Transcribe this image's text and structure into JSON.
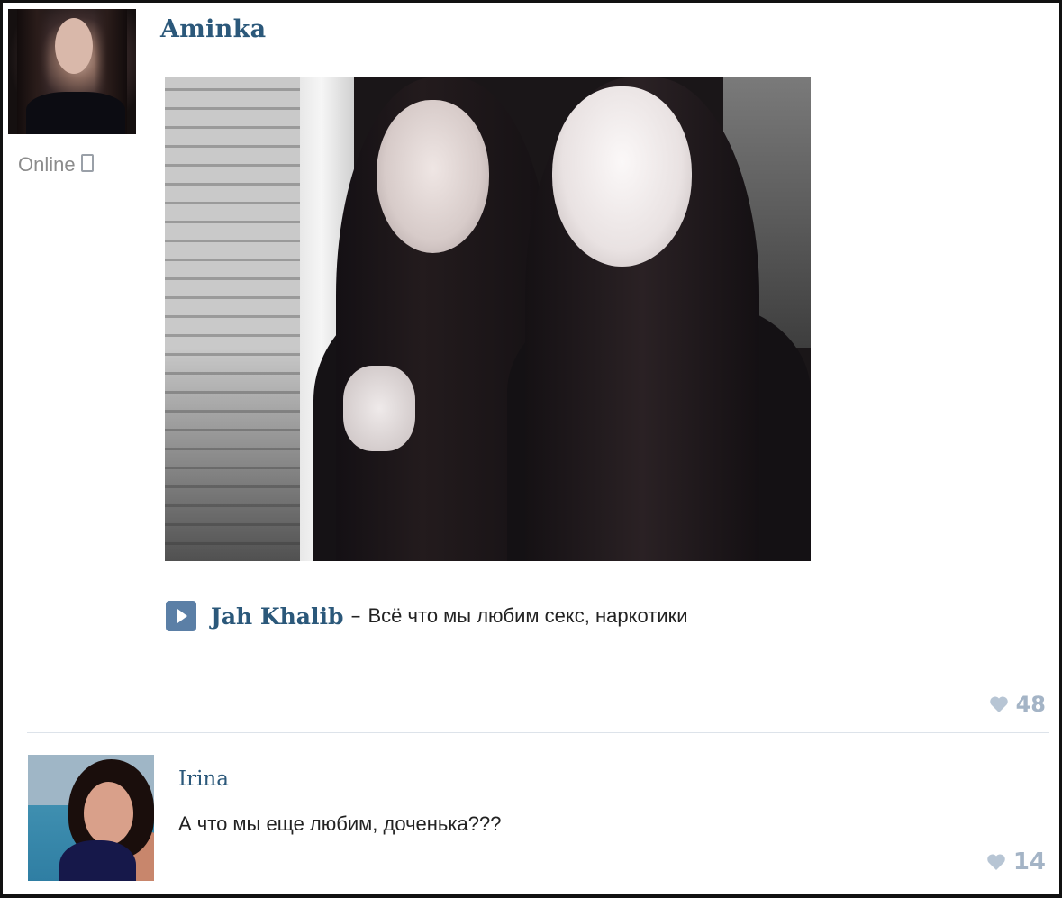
{
  "post": {
    "author": "Aminka",
    "status": "Online",
    "status_icon": "mobile-phone-icon",
    "audio": {
      "artist": "Jah Khalib",
      "separator": "–",
      "title": "Всё что мы любим секс, наркотики"
    },
    "likes": "48"
  },
  "comment": {
    "author": "Irina",
    "text": "А что мы еще любим, доченька???",
    "likes": "14"
  },
  "colors": {
    "link": "#2b587a",
    "play_button": "#5b7fa6",
    "like": "#a4b4c6",
    "status": "#8c8c8c"
  }
}
